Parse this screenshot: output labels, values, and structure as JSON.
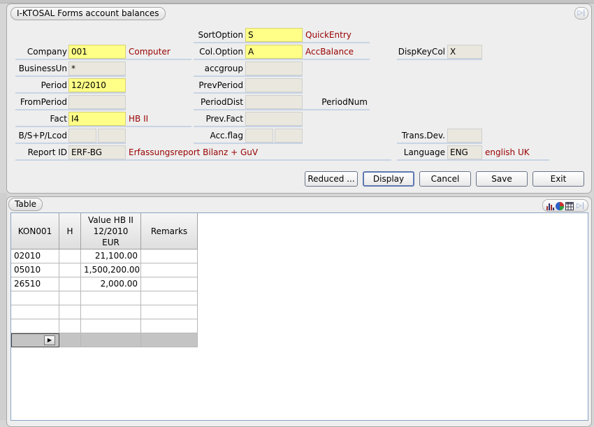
{
  "form": {
    "title": "I-KTOSAL Forms account balances",
    "fields": {
      "sort_option": {
        "label": "SortOption",
        "value": "S",
        "desc": "QuickEntry"
      },
      "company": {
        "label": "Company",
        "value": "001",
        "desc": "Computer"
      },
      "col_option": {
        "label": "Col.Option",
        "value": "A",
        "desc": "AccBalance"
      },
      "disp_key_col": {
        "label": "DispKeyCol",
        "value": "X"
      },
      "business_unit": {
        "label": "BusinessUn",
        "value": "*"
      },
      "accgroup": {
        "label": "accgroup",
        "value": ""
      },
      "period": {
        "label": "Period",
        "value": "12/2010"
      },
      "prev_period": {
        "label": "PrevPeriod",
        "value": ""
      },
      "from_period": {
        "label": "FromPeriod",
        "value": ""
      },
      "period_dist": {
        "label": "PeriodDist",
        "value": ""
      },
      "period_num": {
        "label": "PeriodNum"
      },
      "fact": {
        "label": "Fact",
        "value": "I4",
        "desc": "HB II"
      },
      "prev_fact": {
        "label": "Prev.Fact",
        "value": ""
      },
      "bs_pl": {
        "label": "B/S+P/Lcod",
        "value1": "",
        "value2": ""
      },
      "acc_flag": {
        "label": "Acc.flag",
        "value1": "",
        "value2": ""
      },
      "trans_dev": {
        "label": "Trans.Dev.",
        "value": ""
      },
      "report_id": {
        "label": "Report ID",
        "value": "ERF-BG",
        "desc": "Erfassungsreport Bilanz + GuV"
      },
      "language": {
        "label": "Language",
        "value": "ENG",
        "desc": "english UK"
      }
    },
    "buttons": {
      "reduced": "Reduced ...",
      "display": "Display",
      "cancel": "Cancel",
      "save": "Save",
      "exit": "Exit"
    }
  },
  "table": {
    "title": "Table",
    "columns": {
      "account": "KON001",
      "h": "H",
      "value_line1": "Value HB II",
      "value_line2": "12/2010",
      "value_line3": "EUR",
      "remarks": "Remarks"
    },
    "rows": [
      {
        "account": "02010",
        "h": "",
        "value": "21,100.00",
        "remarks": ""
      },
      {
        "account": "05010",
        "h": "",
        "value": "1,500,200.00",
        "remarks": ""
      },
      {
        "account": "26510",
        "h": "",
        "value": "2,000.00",
        "remarks": ""
      },
      {
        "account": "",
        "h": "",
        "value": "",
        "remarks": ""
      },
      {
        "account": "",
        "h": "",
        "value": "",
        "remarks": ""
      },
      {
        "account": "",
        "h": "",
        "value": "",
        "remarks": ""
      }
    ]
  },
  "colors": {
    "required_field": "#ffff88",
    "description_text": "#990000",
    "panel_bg": "#eeeeee"
  }
}
